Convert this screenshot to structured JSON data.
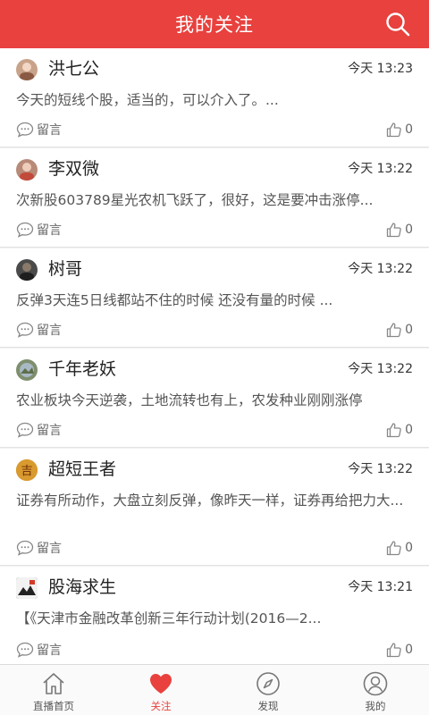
{
  "header": {
    "title": "我的关注"
  },
  "posts": [
    {
      "author": "洪七公",
      "time": "今天 13:23",
      "content": "今天的短线个股，适当的，可以介入了。...",
      "reply_label": "留言",
      "likes": "0",
      "avatar_color": "#c9a28a"
    },
    {
      "author": "李双微",
      "time": "今天 13:22",
      "content": "次新股603789星光农机飞跃了，很好，这是要冲击涨停...",
      "reply_label": "留言",
      "likes": "0",
      "avatar_color": "#b88a78"
    },
    {
      "author": "树哥",
      "time": "今天 13:22",
      "content": "反弹3天连5日线都站不住的时候 还没有量的时候 ...",
      "reply_label": "留言",
      "likes": "0",
      "avatar_color": "#4a4a4a"
    },
    {
      "author": "千年老妖",
      "time": "今天 13:22",
      "content": "农业板块今天逆袭，土地流转也有上，农发种业刚刚涨停",
      "reply_label": "留言",
      "likes": "0",
      "avatar_color": "#7e8f6e"
    },
    {
      "author": "超短王者",
      "time": "今天 13:22",
      "content": "证券有所动作，大盘立刻反弹，像昨天一样，证券再给把力大...",
      "reply_label": "留言",
      "likes": "0",
      "avatar_color": "#c8781e"
    },
    {
      "author": "股海求生",
      "time": "今天 13:21",
      "content": "【《天津市金融改革创新三年行动计划(2016—2...",
      "reply_label": "留言",
      "likes": "0",
      "avatar_color": "#2c2c2c"
    }
  ],
  "tabs": [
    {
      "label": "直播首页"
    },
    {
      "label": "关注"
    },
    {
      "label": "发现"
    },
    {
      "label": "我的"
    }
  ],
  "colors": {
    "accent": "#e8413e"
  }
}
